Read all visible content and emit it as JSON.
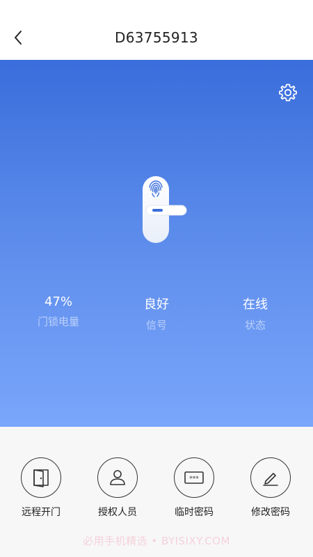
{
  "header": {
    "title": "D63755913"
  },
  "stats": [
    {
      "value": "47%",
      "label": "门锁电量"
    },
    {
      "value": "良好",
      "label": "信号"
    },
    {
      "value": "在线",
      "label": "状态"
    }
  ],
  "actions": [
    {
      "label": "远程开门",
      "icon": "door-icon"
    },
    {
      "label": "授权人员",
      "icon": "user-icon"
    },
    {
      "label": "临时密码",
      "icon": "password-icon"
    },
    {
      "label": "修改密码",
      "icon": "edit-icon"
    }
  ],
  "watermark": "必用手机精选 • BYISIXY.COM",
  "colors": {
    "hero_top": "#3a6ddb",
    "hero_bottom": "#7aa6fb",
    "accent": "#3a6ddb"
  }
}
